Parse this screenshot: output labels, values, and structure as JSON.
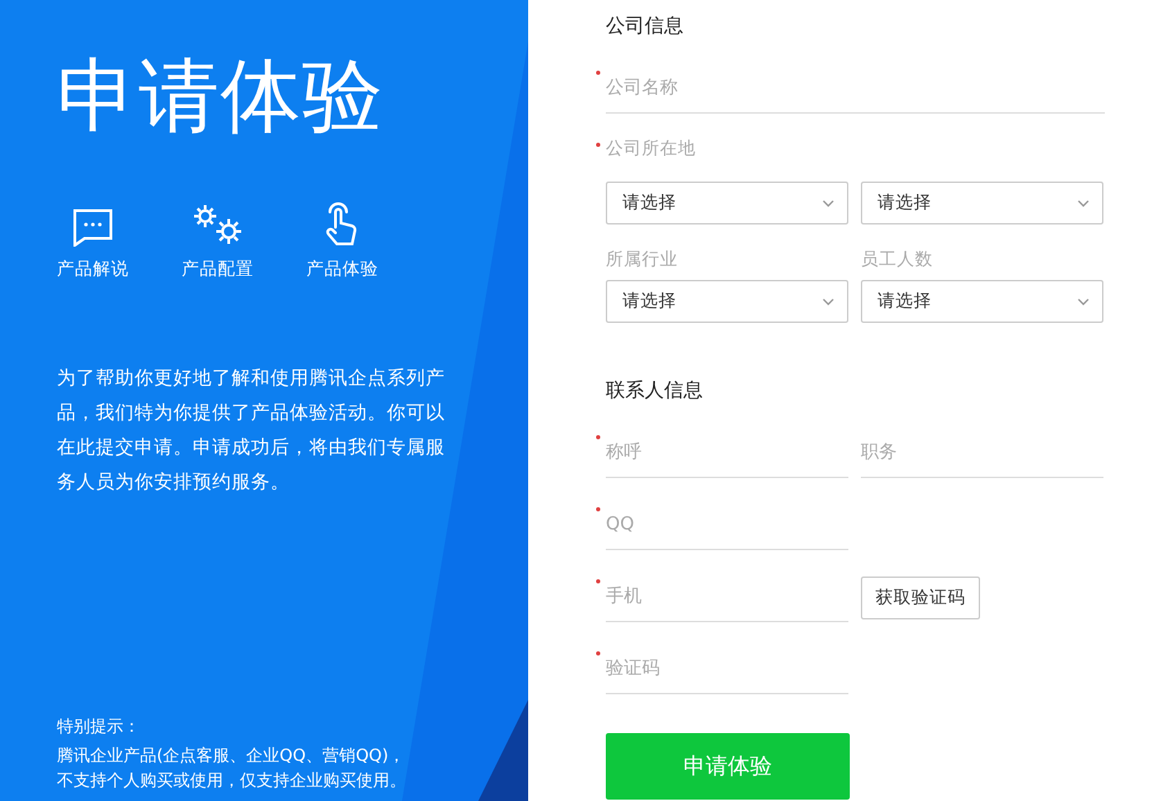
{
  "intro": {
    "title": "申请体验",
    "features": [
      {
        "label": "产品解说",
        "kind": "chat"
      },
      {
        "label": "产品配置",
        "kind": "gears"
      },
      {
        "label": "产品体验",
        "kind": "touch"
      }
    ],
    "description": "为了帮助你更好地了解和使用腾讯企点系列产品，我们特为你提供了产品体验活动。你可以在此提交申请。申请成功后，将由我们专属服务人员为你安排预约服务。",
    "notice_title": "特别提示：",
    "notice_lines": [
      "腾讯企业产品(企点客服、企业QQ、营销QQ)，",
      "不支持个人购买或使用，仅支持企业购买使用。"
    ]
  },
  "sections": [
    {
      "title": "公司信息",
      "rows": [
        {
          "kind": "wide-text",
          "placeholder": "公司名称",
          "required": true
        },
        {
          "kind": "select-pair",
          "label": "公司所在地",
          "required": true,
          "selects": [
            "请选择",
            "请选择"
          ]
        },
        {
          "kind": "labeled-selects",
          "items": [
            {
              "label": "所属行业",
              "required": false,
              "value": "请选择"
            },
            {
              "label": "员工人数",
              "required": false,
              "value": "请选择"
            }
          ]
        }
      ]
    },
    {
      "title": "联系人信息",
      "rows": [
        {
          "kind": "text-pair",
          "items": [
            {
              "placeholder": "称呼",
              "required": true
            },
            {
              "placeholder": "职务",
              "required": false
            }
          ]
        },
        {
          "kind": "text",
          "placeholder": "QQ",
          "required": true
        },
        {
          "kind": "text-button",
          "placeholder": "手机",
          "required": true,
          "button": "获取验证码"
        },
        {
          "kind": "text",
          "placeholder": "验证码",
          "required": true
        }
      ]
    }
  ],
  "submit": "申请体验"
}
